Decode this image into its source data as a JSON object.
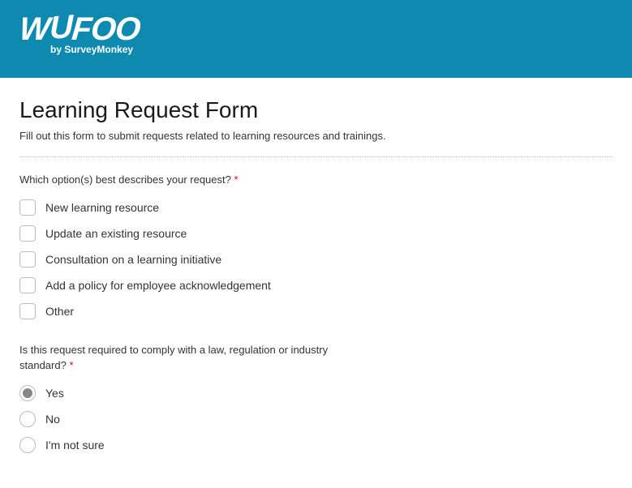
{
  "header": {
    "logo_main": "WUFOO",
    "logo_sub": "by SurveyMonkey"
  },
  "form": {
    "title": "Learning Request Form",
    "subtitle": "Fill out this form to submit requests related to learning resources and trainings."
  },
  "q1": {
    "label": "Which option(s) best describes your request?",
    "required_mark": "*",
    "options": [
      "New learning resource",
      "Update an existing resource",
      "Consultation on a learning initiative",
      "Add a policy for employee acknowledgement",
      "Other"
    ]
  },
  "q2": {
    "label": "Is this request required to comply with a law, regulation or industry standard?",
    "required_mark": "*",
    "options": [
      "Yes",
      "No",
      "I'm not sure"
    ],
    "selected_index": 0
  }
}
